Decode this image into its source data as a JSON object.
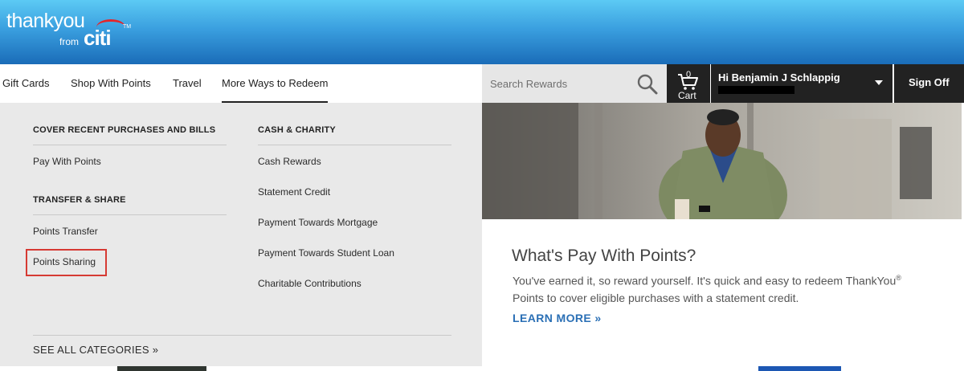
{
  "logo": {
    "line1": "thankyou",
    "line2": "from",
    "brand": "citi",
    "tm": "TM"
  },
  "nav": {
    "items": [
      {
        "label": "Gift Cards"
      },
      {
        "label": "Shop With Points"
      },
      {
        "label": "Travel"
      },
      {
        "label": "More Ways to Redeem",
        "active": true
      }
    ]
  },
  "search": {
    "placeholder": "Search Rewards",
    "icon": "search-icon"
  },
  "cart": {
    "count": "0",
    "label": "Cart",
    "icon": "cart-icon"
  },
  "user": {
    "greeting": "Hi Benjamin J Schlappig",
    "icon": "chevron-down-icon"
  },
  "signoff": {
    "label": "Sign Off"
  },
  "dropdown": {
    "col1": {
      "section1": {
        "heading": "COVER RECENT PURCHASES AND BILLS",
        "links": [
          "Pay With Points"
        ]
      },
      "section2": {
        "heading": "TRANSFER & SHARE",
        "links": [
          "Points Transfer",
          "Points Sharing"
        ]
      }
    },
    "col2": {
      "section1": {
        "heading": "CASH & CHARITY",
        "links": [
          "Cash Rewards",
          "Statement Credit",
          "Payment Towards Mortgage",
          "Payment Towards Student Loan",
          "Charitable Contributions"
        ]
      }
    },
    "see_all": "SEE ALL CATEGORIES »",
    "highlight_color": "#d63a33"
  },
  "promo": {
    "title": "What's Pay With Points?",
    "body_part1": "You've earned it, so reward yourself. It's quick and easy to redeem ThankYou",
    "body_sup": "®",
    "body_part2": "Points to cover eligible purchases with a statement credit.",
    "link": "LEARN MORE »"
  },
  "colors": {
    "banner_top": "#5ccaf4",
    "banner_bottom": "#1a6cb8",
    "account_bar": "#222222",
    "dropdown_bg": "#e9e9e9",
    "link_blue": "#2a6fb5",
    "citi_red": "#e3262b"
  }
}
